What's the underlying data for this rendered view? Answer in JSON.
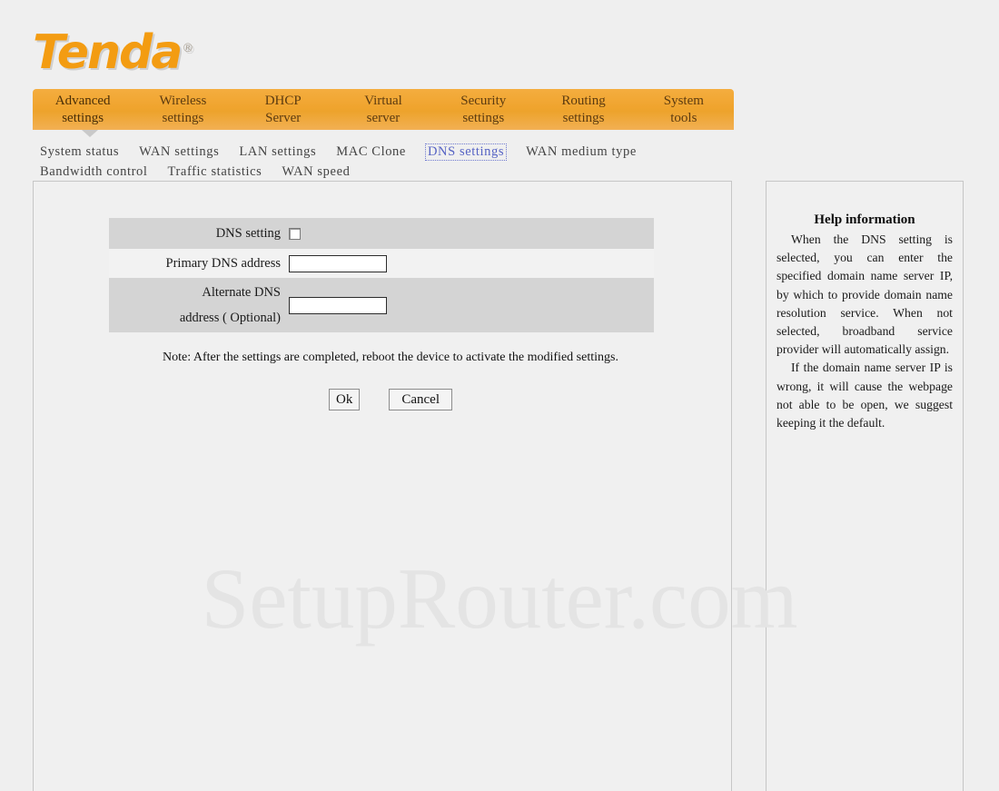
{
  "brand": {
    "name": "Tenda",
    "registered_mark": "®",
    "accent_color": "#F39C12"
  },
  "main_tabs": [
    {
      "line1": "Advanced",
      "line2": "settings",
      "active": true
    },
    {
      "line1": "Wireless",
      "line2": "settings",
      "active": false
    },
    {
      "line1": "DHCP",
      "line2": "Server",
      "active": false
    },
    {
      "line1": "Virtual",
      "line2": "server",
      "active": false
    },
    {
      "line1": "Security",
      "line2": "settings",
      "active": false
    },
    {
      "line1": "Routing",
      "line2": "settings",
      "active": false
    },
    {
      "line1": "System",
      "line2": "tools",
      "active": false
    }
  ],
  "sub_nav": {
    "row1": [
      {
        "label": "System status",
        "current": false
      },
      {
        "label": "WAN settings",
        "current": false
      },
      {
        "label": "LAN settings",
        "current": false
      },
      {
        "label": "MAC Clone",
        "current": false
      },
      {
        "label": "DNS settings",
        "current": true
      },
      {
        "label": "WAN medium type",
        "current": false
      }
    ],
    "row2": [
      {
        "label": "Bandwidth control",
        "current": false
      },
      {
        "label": "Traffic statistics",
        "current": false
      },
      {
        "label": "WAN speed",
        "current": false
      }
    ]
  },
  "form": {
    "dns_setting_label": "DNS setting",
    "dns_setting_checked": false,
    "primary_label": "Primary DNS address",
    "primary_value": "",
    "alternate_label_line1": "Alternate DNS",
    "alternate_label_line2": "address ( Optional)",
    "alternate_value": "",
    "note": "Note: After the settings are completed, reboot the device to activate the modified settings.",
    "ok_label": "Ok",
    "cancel_label": "Cancel"
  },
  "help": {
    "title": "Help information",
    "paragraph1": "When the DNS setting is selected, you can enter the specified domain name server IP, by which to provide domain name resolution service. When not selected, broadband service provider will automatically assign.",
    "paragraph2": "If the domain name server IP is wrong, it will cause the webpage not able to be open, we suggest keeping it the default."
  },
  "watermark": {
    "text": "SetupRouter.com"
  }
}
